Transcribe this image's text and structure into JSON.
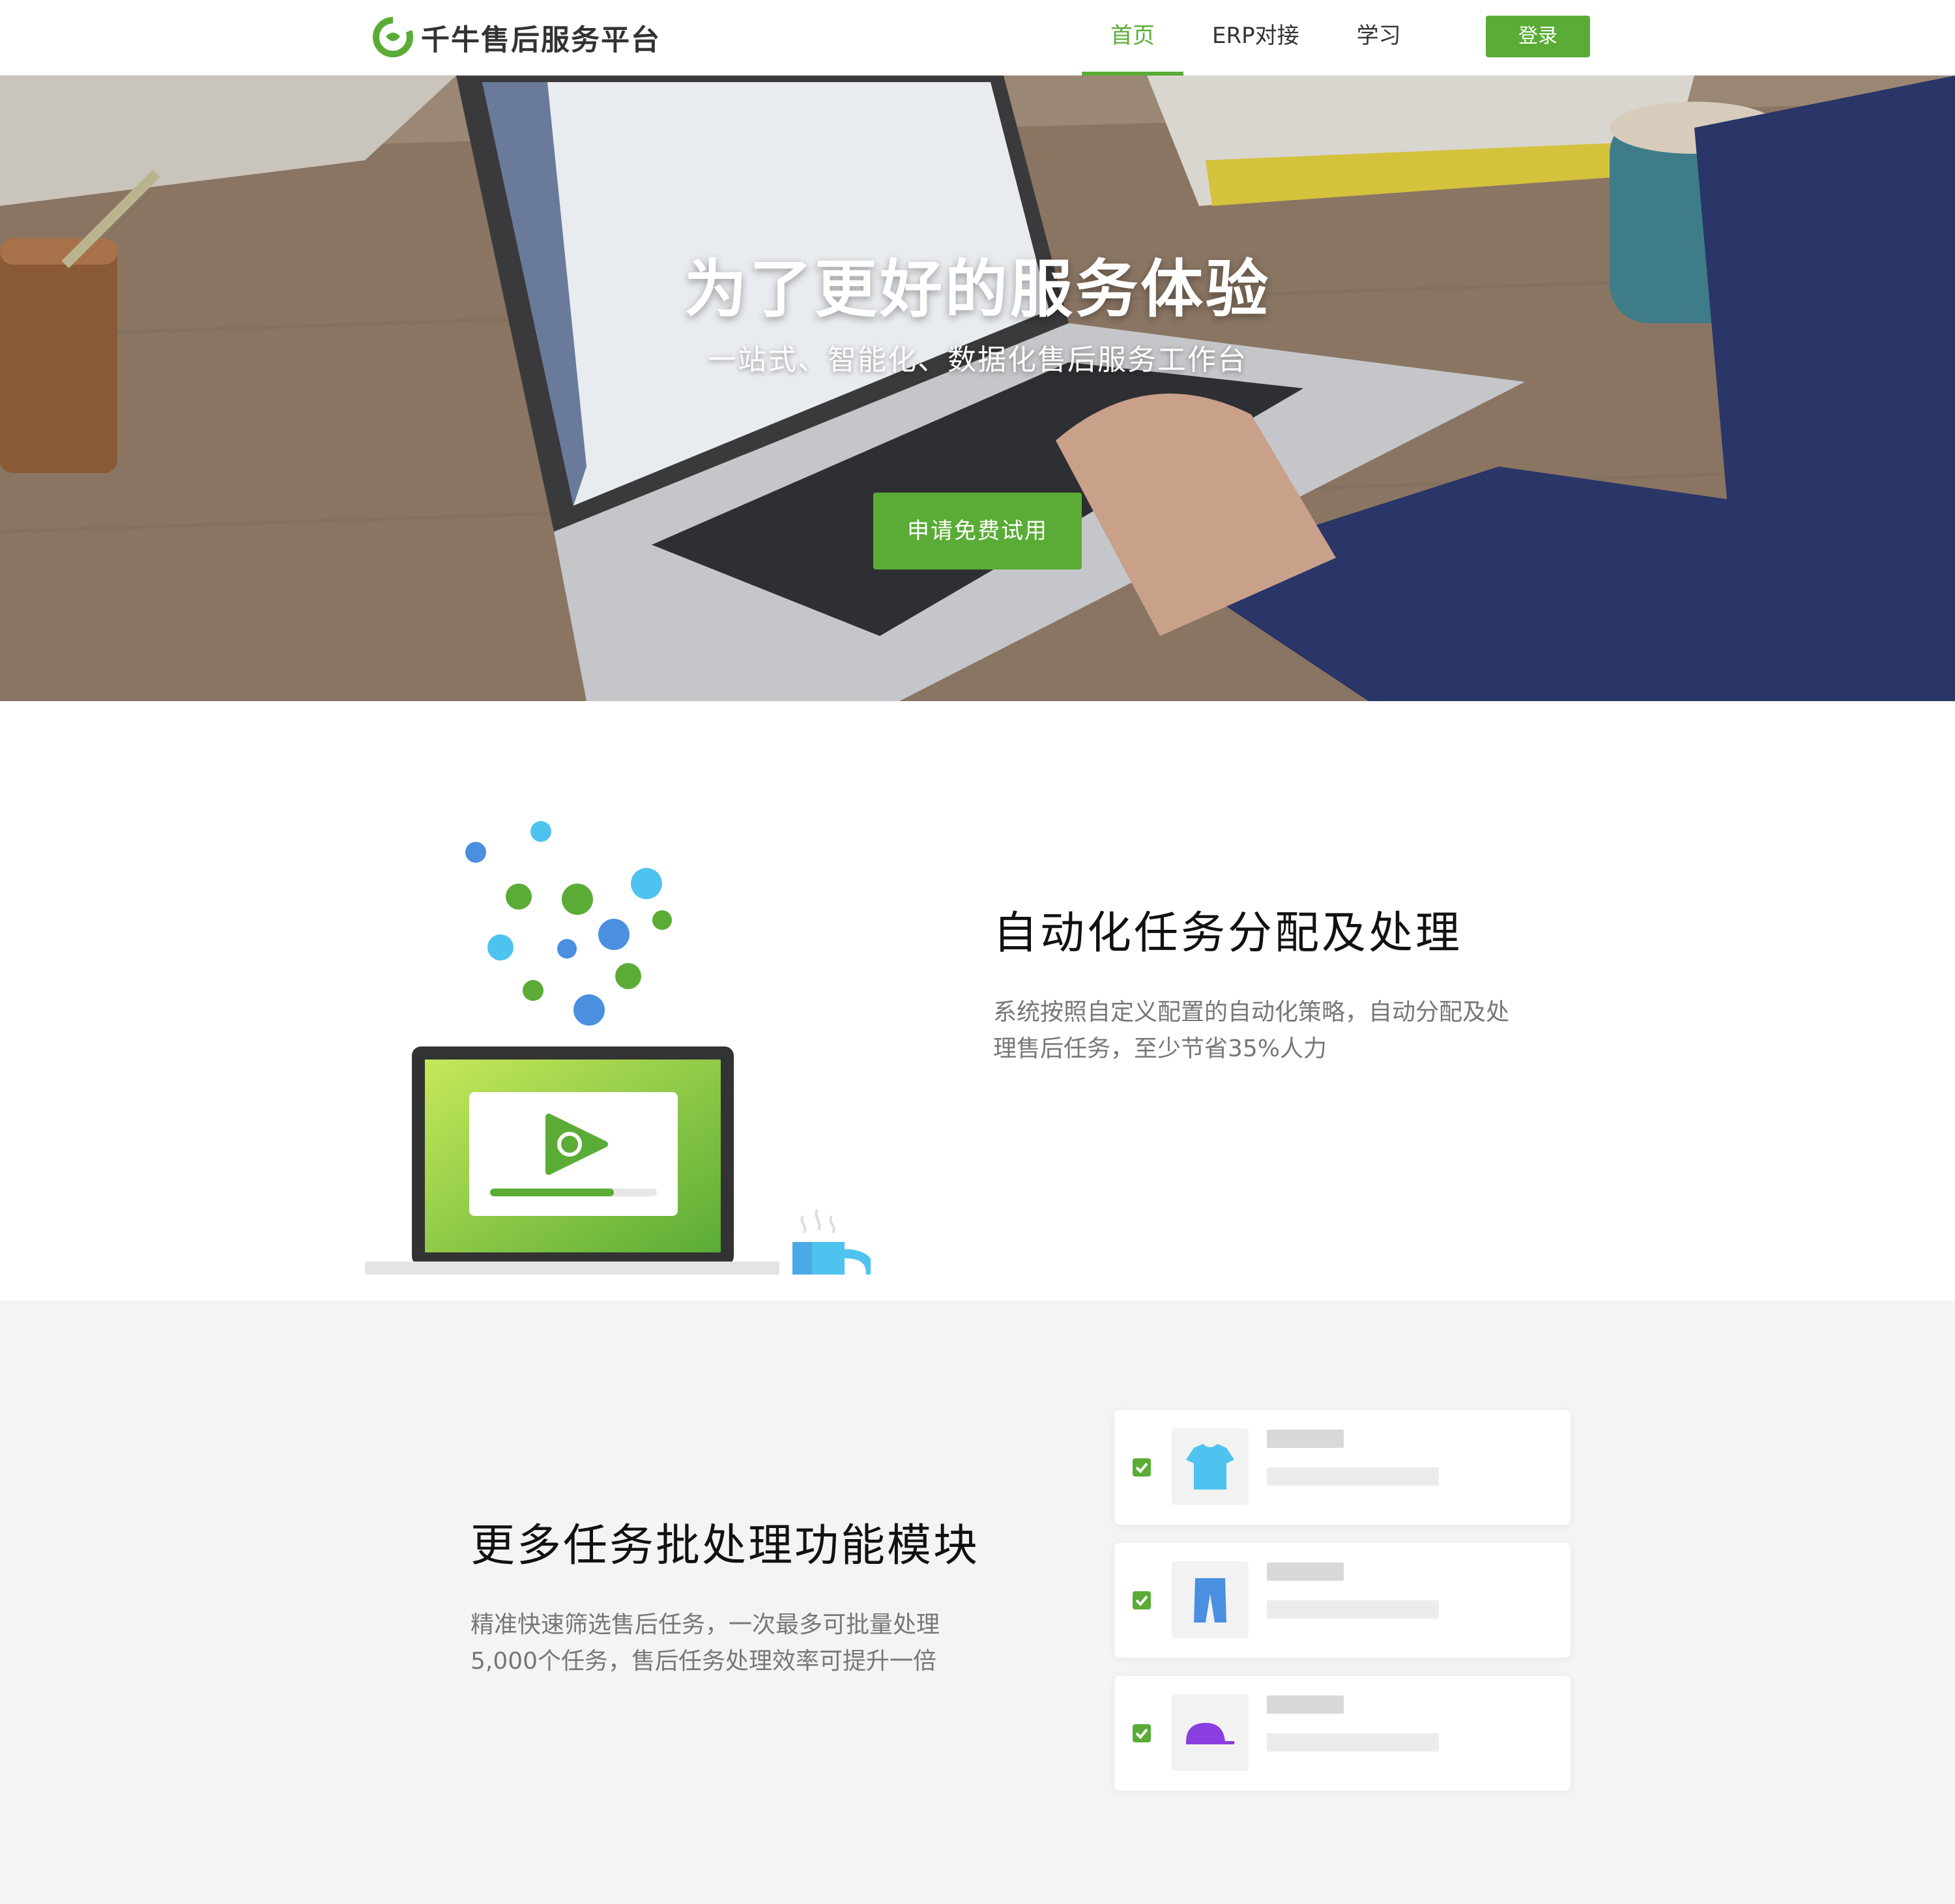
{
  "header": {
    "logo_text": "千牛售后服务平台",
    "nav": [
      {
        "label": "首页",
        "active": true
      },
      {
        "label": "ERP对接",
        "active": false
      },
      {
        "label": "学习",
        "active": false
      }
    ],
    "login_label": "登录"
  },
  "hero": {
    "title": "为了更好的服务体验",
    "subtitle": "一站式、智能化、数据化售后服务工作台",
    "cta_label": "申请免费试用"
  },
  "section1": {
    "title": "自动化任务分配及处理",
    "description": "系统按照自定义配置的自动化策略，自动分配及处理售后任务，至少节省35%人力"
  },
  "section2": {
    "title": "更多任务批处理功能模块",
    "description": "精准快速筛选售后任务，一次最多可批量处理5,000个任务，售后任务处理效率可提升一倍",
    "cards": [
      {
        "icon": "tshirt-icon",
        "color": "#4fc3f0",
        "checked": true
      },
      {
        "icon": "pants-icon",
        "color": "#4a8fe0",
        "checked": true
      },
      {
        "icon": "cap-icon",
        "color": "#8a3ee0",
        "checked": true
      }
    ]
  },
  "colors": {
    "brand_green": "#5aac36",
    "section_gray": "#f4f4f4"
  }
}
